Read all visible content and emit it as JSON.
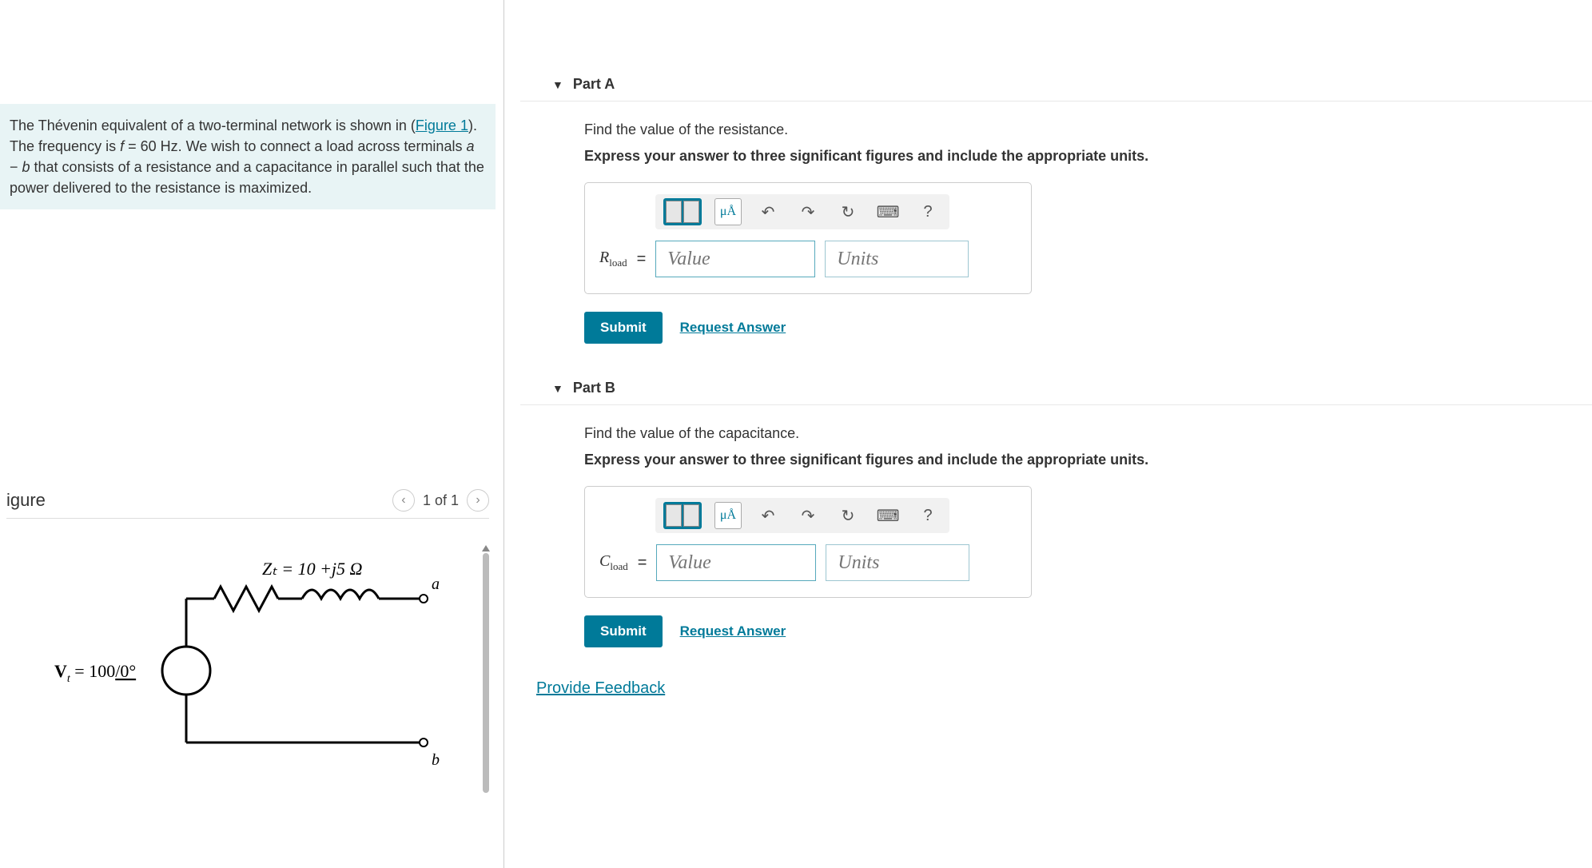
{
  "problem": {
    "text_before_link": "The Thévenin equivalent of a two-terminal network is shown in (",
    "figure_link": "Figure 1",
    "text_after_link": "). The frequency is ",
    "freq_var": "f",
    "freq_eq": " = 60 Hz. We wish to connect a load across terminals ",
    "term_a": "a",
    "dash": " − ",
    "term_b": "b",
    "text_tail": " that consists of a resistance and a capacitance in parallel such that the power delivered to the resistance is maximized."
  },
  "figure": {
    "title": "igure",
    "nav_label": "1 of 1",
    "impedance_label": "Zₜ = 10 +j5 Ω",
    "voltage_label": "Vₜ = 100∠0°",
    "terminal_a": "a",
    "terminal_b": "b"
  },
  "partA": {
    "title": "Part A",
    "prompt": "Find the value of the resistance.",
    "instruction": "Express your answer to three significant figures and include the appropriate units.",
    "var_main": "R",
    "var_sub": "load",
    "value_placeholder": "Value",
    "units_placeholder": "Units",
    "submit": "Submit",
    "request": "Request Answer"
  },
  "partB": {
    "title": "Part B",
    "prompt": "Find the value of the capacitance.",
    "instruction": "Express your answer to three significant figures and include the appropriate units.",
    "var_main": "C",
    "var_sub": "load",
    "value_placeholder": "Value",
    "units_placeholder": "Units",
    "submit": "Submit",
    "request": "Request Answer"
  },
  "feedback": "Provide Feedback",
  "icons": {
    "mu_a": "μÅ",
    "help": "?"
  }
}
